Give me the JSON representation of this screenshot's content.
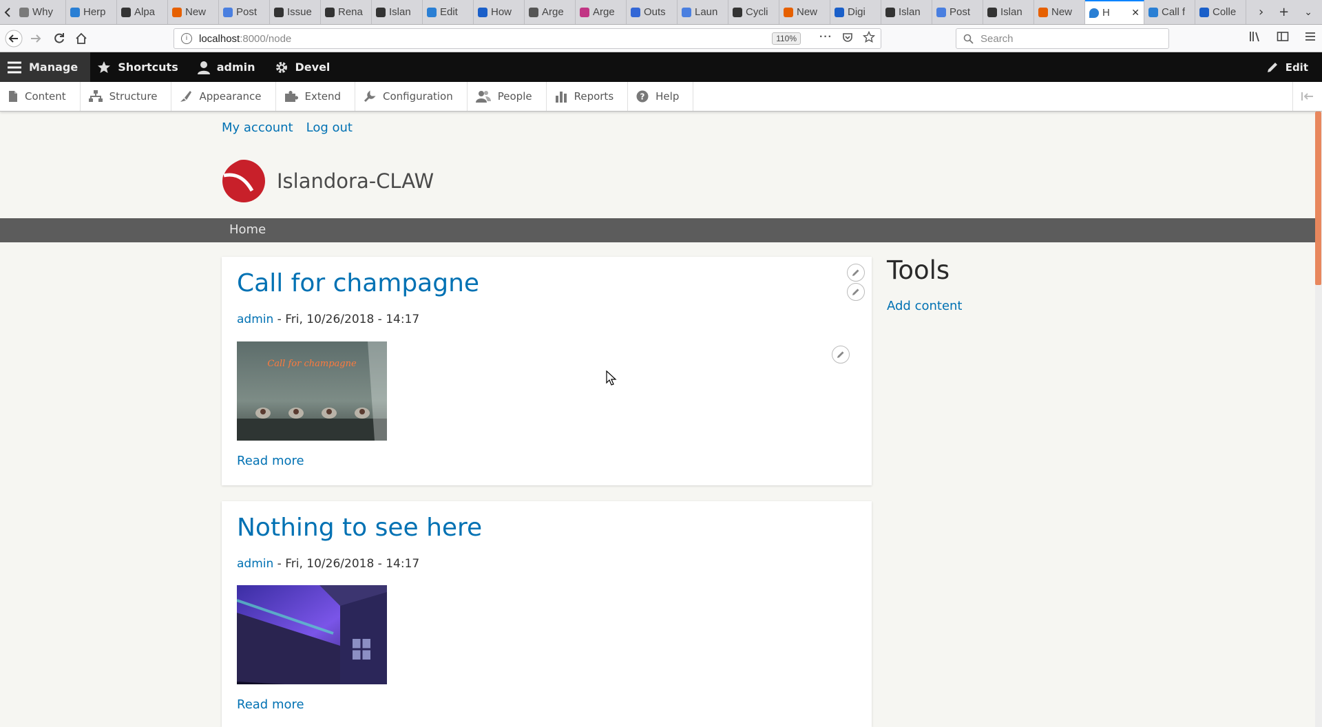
{
  "browser": {
    "tabs": [
      {
        "label": "Why",
        "color": "#7a7a7a"
      },
      {
        "label": "Herp",
        "color": "#2a7fd4"
      },
      {
        "label": "Alpa",
        "color": "#333333"
      },
      {
        "label": "New",
        "color": "#e66000"
      },
      {
        "label": "Post",
        "color": "#4a7fe0"
      },
      {
        "label": "Issue",
        "color": "#333333"
      },
      {
        "label": "Rena",
        "color": "#333333"
      },
      {
        "label": "Islan",
        "color": "#333333"
      },
      {
        "label": "Edit",
        "color": "#2a7fd4"
      },
      {
        "label": "How",
        "color": "#1a5fc9"
      },
      {
        "label": "Arge",
        "color": "#555555"
      },
      {
        "label": "Arge",
        "color": "#c13584"
      },
      {
        "label": "Outs",
        "color": "#3367d6"
      },
      {
        "label": "Laun",
        "color": "#4a7fe0"
      },
      {
        "label": "Cycli",
        "color": "#333333"
      },
      {
        "label": "New",
        "color": "#e66000"
      },
      {
        "label": "Digi",
        "color": "#1a5fc9"
      },
      {
        "label": "Islan",
        "color": "#333333"
      },
      {
        "label": "Post",
        "color": "#4a7fe0"
      },
      {
        "label": "Islan",
        "color": "#333333"
      },
      {
        "label": "New",
        "color": "#e66000"
      }
    ],
    "active_tab": {
      "label": "H",
      "color": "#2a7fd4"
    },
    "trailing_tabs": [
      {
        "label": "Call f",
        "color": "#2a7fd4"
      },
      {
        "label": "Colle",
        "color": "#1a5fc9"
      }
    ],
    "url": {
      "host": "localhost",
      "path": ":8000/node"
    },
    "zoom": "110%",
    "search_placeholder": "Search"
  },
  "toolbar": {
    "manage": "Manage",
    "shortcuts": "Shortcuts",
    "user": "admin",
    "devel": "Devel",
    "edit": "Edit"
  },
  "tray": {
    "items": [
      "Content",
      "Structure",
      "Appearance",
      "Extend",
      "Configuration",
      "People",
      "Reports",
      "Help"
    ]
  },
  "site": {
    "secondary_links": [
      "My account",
      "Log out"
    ],
    "name": "Islandora-CLAW",
    "primary_menu": "Home"
  },
  "nodes": [
    {
      "title": "Call for champagne",
      "author": "admin",
      "date": " - Fri, 10/26/2018 - 14:17",
      "neon_text": "Call for champagne",
      "read_more": "Read more"
    },
    {
      "title": "Nothing to see here",
      "author": "admin",
      "date": " - Fri, 10/26/2018 - 14:17",
      "read_more": "Read more"
    }
  ],
  "sidebar": {
    "title": "Tools",
    "link": "Add content"
  },
  "colors": {
    "link": "#0071b3",
    "toolbar_bg": "#0f0f0f",
    "menu_bar": "#5c5c5c",
    "brand_red": "#c8202a"
  }
}
